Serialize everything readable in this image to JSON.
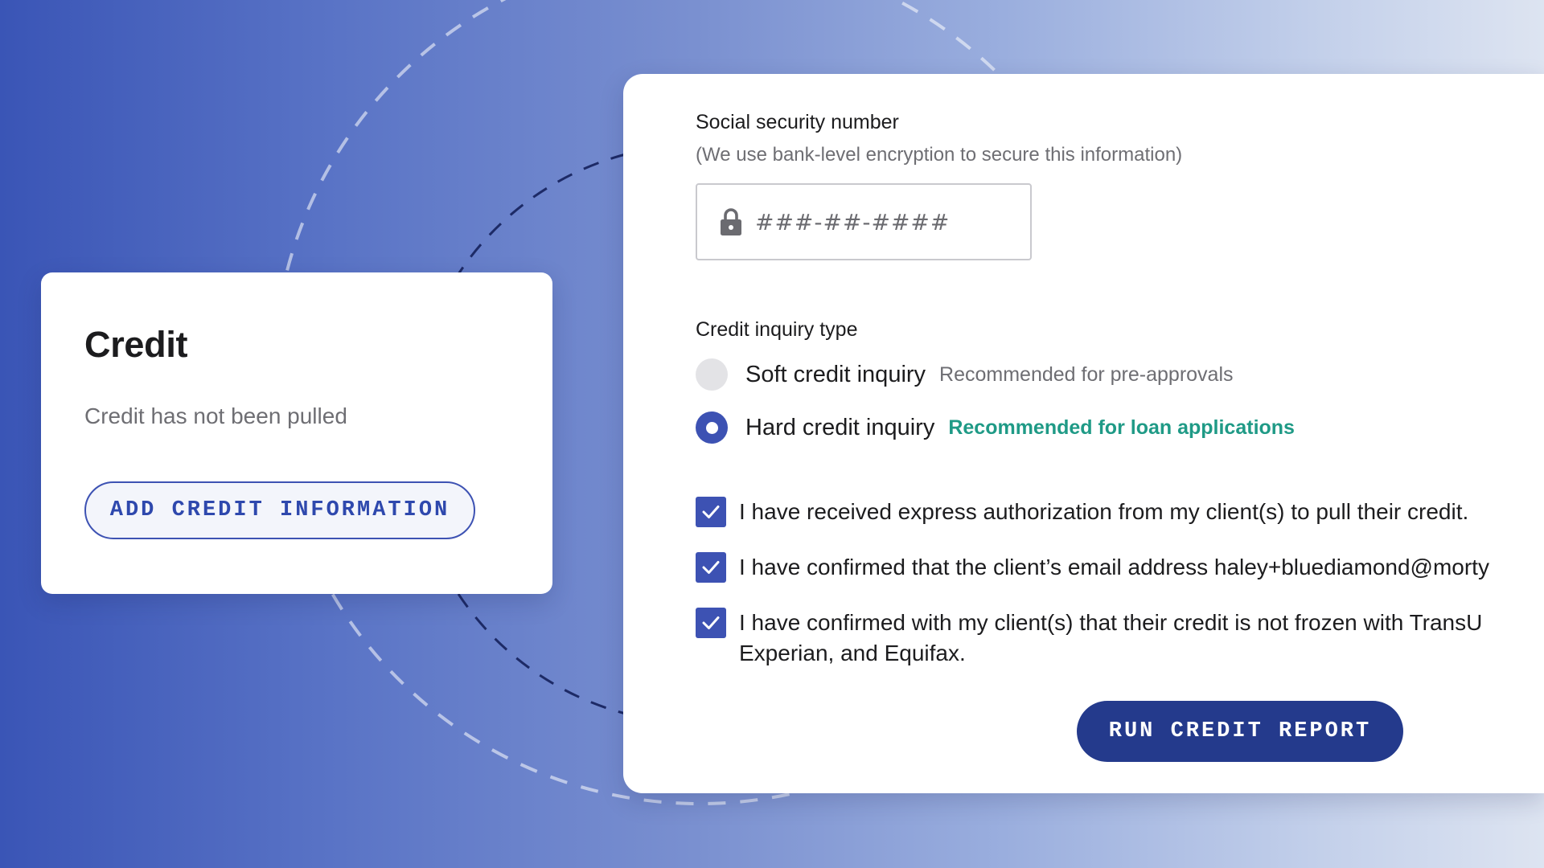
{
  "credit_card": {
    "title": "Credit",
    "status": "Credit has not been pulled",
    "add_button_label": "ADD CREDIT INFORMATION"
  },
  "ssn": {
    "label": "Social security number",
    "help": "(We use bank-level encryption to secure this information)",
    "placeholder": "###-##-####",
    "value": "",
    "icon": "lock-icon"
  },
  "inquiry": {
    "label": "Credit inquiry type",
    "options": [
      {
        "label": "Soft credit inquiry",
        "hint": "Recommended for pre-approvals",
        "selected": false
      },
      {
        "label": "Hard credit inquiry",
        "hint": "Recommended for loan applications",
        "selected": true
      }
    ]
  },
  "confirmations": [
    {
      "text": "I have received express authorization from my client(s) to pull their credit.",
      "checked": true
    },
    {
      "text": "I have confirmed that the client’s email address haley+bluediamond@morty",
      "checked": true
    },
    {
      "text": "I have confirmed with my client(s) that their credit is not frozen with TransU Experian, and Equifax.",
      "checked": true
    }
  ],
  "run_button_label": "RUN CREDIT REPORT",
  "colors": {
    "primary": "#3d52b3",
    "primary_dark": "#243a8c",
    "recommend_green": "#1f9a86"
  }
}
